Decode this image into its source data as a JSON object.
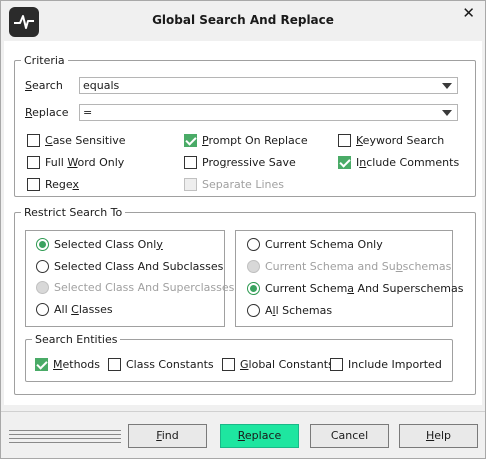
{
  "window": {
    "title": "Global Search And Replace",
    "close_glyph": "✕",
    "logo_icon": "waveform-logo-icon"
  },
  "criteria": {
    "legend": "Criteria",
    "search": {
      "label_pre": "",
      "label_u": "S",
      "label_post": "earch",
      "value": "equals"
    },
    "replace": {
      "label_pre": "",
      "label_u": "R",
      "label_post": "eplace",
      "value": "="
    },
    "options": {
      "case_sensitive": {
        "pre": "",
        "u": "C",
        "post": "ase Sensitive",
        "checked": false
      },
      "prompt_on_replace": {
        "pre": "",
        "u": "P",
        "post": "rompt On Replace",
        "checked": true
      },
      "keyword_search": {
        "pre": "",
        "u": "K",
        "post": "eyword Search",
        "checked": false
      },
      "full_word_only": {
        "pre": "Full ",
        "u": "W",
        "post": "ord Only",
        "checked": false
      },
      "progressive_save": {
        "pre": "Pro",
        "u": "g",
        "post": "ressive Save",
        "checked": false
      },
      "include_comments": {
        "pre": "I",
        "u": "n",
        "post": "clude Comments",
        "checked": true
      },
      "regex": {
        "pre": "Rege",
        "u": "x",
        "post": "",
        "checked": false
      },
      "separate_lines": {
        "label": "Separate Lines",
        "checked": false,
        "disabled": true
      }
    }
  },
  "restrict": {
    "legend": "Restrict Search To",
    "class_scope": [
      {
        "pre": "Selected Class Onl",
        "u": "y",
        "post": "",
        "selected": true,
        "disabled": false
      },
      {
        "pre": "Selected Class And Subclasses",
        "u": "",
        "post": "",
        "selected": false,
        "disabled": false
      },
      {
        "pre": "Selected Class And Superclasses",
        "u": "",
        "post": "",
        "selected": false,
        "disabled": true
      },
      {
        "pre": "All ",
        "u": "C",
        "post": "lasses",
        "selected": false,
        "disabled": false
      }
    ],
    "schema_scope": [
      {
        "pre": "Current Schema Only",
        "u": "",
        "post": "",
        "selected": false,
        "disabled": false
      },
      {
        "pre": "Current Schema and Su",
        "u": "b",
        "post": "schemas",
        "selected": false,
        "disabled": true
      },
      {
        "pre": "Current Schem",
        "u": "a",
        "post": " And Superschemas",
        "selected": true,
        "disabled": false
      },
      {
        "pre": "A",
        "u": "l",
        "post": "l Schemas",
        "selected": false,
        "disabled": false
      }
    ]
  },
  "entities": {
    "legend": "Search Entities",
    "items": [
      {
        "pre": "",
        "u": "M",
        "post": "ethods",
        "checked": true
      },
      {
        "pre": "Class Constants",
        "u": "",
        "post": "",
        "checked": false
      },
      {
        "pre": "",
        "u": "G",
        "post": "lobal Constants",
        "checked": false
      },
      {
        "pre": "Include Imported",
        "u": "",
        "post": "",
        "checked": false
      }
    ]
  },
  "buttons": {
    "find": {
      "pre": "",
      "u": "F",
      "post": "ind"
    },
    "replace": {
      "pre": "",
      "u": "R",
      "post": "eplace"
    },
    "cancel": {
      "pre": "Cancel",
      "u": "",
      "post": ""
    },
    "help": {
      "pre": "",
      "u": "H",
      "post": "elp"
    }
  },
  "colors": {
    "accent_button": "#1ee6a0",
    "check_green": "#4aab67"
  }
}
